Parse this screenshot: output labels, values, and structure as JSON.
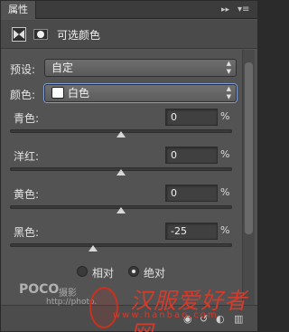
{
  "panel": {
    "tab_label": "属性",
    "tab_controls": "▸▸",
    "menu_icon": "panel-menu-icon",
    "title": "可选颜色"
  },
  "preset": {
    "label": "预设:",
    "value": "自定"
  },
  "colors": {
    "label": "颜色:",
    "value": "白色",
    "swatch_color": "#ffffff"
  },
  "sliders": [
    {
      "label": "青色:",
      "value": "0",
      "unit": "%",
      "level": 0
    },
    {
      "label": "洋红:",
      "value": "0",
      "unit": "%",
      "level": 0
    },
    {
      "label": "黄色:",
      "value": "0",
      "unit": "%",
      "level": 0
    },
    {
      "label": "黑色:",
      "value": "-25",
      "unit": "%",
      "level": -25
    }
  ],
  "method": {
    "options": [
      "相对",
      "绝对"
    ],
    "selected": "绝对"
  },
  "watermark": {
    "poco_logo": "POCO",
    "poco_text": "摄影",
    "poco_url": "http://photo.",
    "site_name": "汉服爱好者网",
    "site_url": "www.hanbao.com"
  },
  "accent_colors": {
    "panel_bg": "#535353",
    "focus": "#7fa0d8",
    "watermark_red": "#d63a2a"
  }
}
